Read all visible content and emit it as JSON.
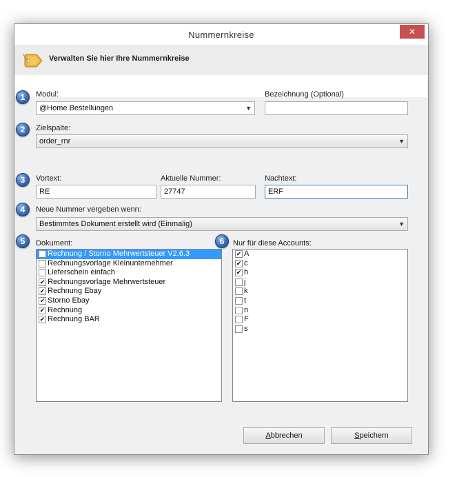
{
  "window": {
    "title": "Nummernkreise",
    "close_glyph": "✕"
  },
  "header": {
    "title": "Verwalten Sie hier Ihre Nummernkreise",
    "icon": "tag-icon"
  },
  "steps": [
    "1",
    "2",
    "3",
    "4",
    "5",
    "6"
  ],
  "modul": {
    "label": "Modul:",
    "value": "@Home Bestellungen"
  },
  "bezeichnung": {
    "label": "Bezeichnung (Optional)",
    "value": ""
  },
  "zielspalte": {
    "label": "Zielspalte:",
    "value": "order_rnr"
  },
  "vortext": {
    "label": "Vortext:",
    "value": "RE"
  },
  "aktuelle_nummer": {
    "label": "Aktuelle Nummer:",
    "value": "27747"
  },
  "nachtext": {
    "label": "Nachtext:",
    "value": "ERF"
  },
  "neue_nummer": {
    "label": "Neue Nummer vergeben wenn:",
    "value": "Bestimmtes Dokument erstellt wird (Einmalig)"
  },
  "dokument": {
    "label": "Dokument:",
    "items": [
      {
        "label": "Rechnung / Storno Mehrwertsteuer V2.6.3",
        "checked": false,
        "selected": true
      },
      {
        "label": "Rechnungsvorlage Kleinunternehmer",
        "checked": false,
        "selected": false
      },
      {
        "label": "Lieferschein einfach",
        "checked": false,
        "selected": false
      },
      {
        "label": "Rechnungsvorlage Mehrwertsteuer",
        "checked": true,
        "selected": false
      },
      {
        "label": "Rechnung Ebay",
        "checked": true,
        "selected": false
      },
      {
        "label": "Storno Ebay",
        "checked": true,
        "selected": false
      },
      {
        "label": "Rechnung",
        "checked": true,
        "selected": false
      },
      {
        "label": "Rechnung BAR",
        "checked": true,
        "selected": false
      }
    ]
  },
  "accounts": {
    "label": "Nur für diese Accounts:",
    "items": [
      {
        "label": "A",
        "checked": true
      },
      {
        "label": "c",
        "checked": true
      },
      {
        "label": "h",
        "checked": true
      },
      {
        "label": "j",
        "checked": false
      },
      {
        "label": "k",
        "checked": false
      },
      {
        "label": "t",
        "checked": false
      },
      {
        "label": "n",
        "checked": false
      },
      {
        "label": "F",
        "checked": false
      },
      {
        "label": "s",
        "checked": false
      }
    ]
  },
  "buttons": {
    "cancel": {
      "mnemonic": "A",
      "rest": "bbrechen"
    },
    "save": {
      "mnemonic": "S",
      "rest": "peichern"
    }
  },
  "colors": {
    "selection": "#3399ff",
    "badge": "#3d6fb5",
    "close": "#c75050",
    "tag": "#f0b73c"
  }
}
